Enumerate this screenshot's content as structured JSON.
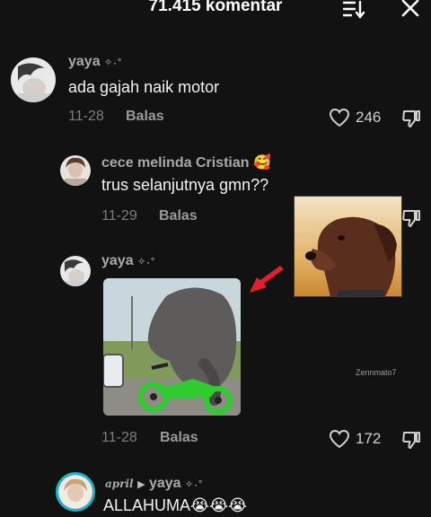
{
  "header": {
    "title": "71.415 komentar",
    "sort_icon": "sort-icon",
    "close_icon": "close-icon"
  },
  "comments": [
    {
      "username": "yaya",
      "badge": "✧˖°",
      "text": "ada gajah naik motor",
      "date": "11-28",
      "reply_label": "Balas",
      "likes": "246"
    },
    {
      "username": "cece melinda Cristian",
      "badge": "🥰",
      "text": "trus selanjutnya gmn??",
      "date": "11-29",
      "reply_label": "Balas"
    },
    {
      "username": "yaya",
      "badge": "✧˖°",
      "date": "11-28",
      "reply_label": "Balas",
      "likes": "172"
    },
    {
      "username": "april",
      "reply_to": "yaya",
      "badge": "✧˖°",
      "text": "ALLAHUMA😭😭😭"
    }
  ],
  "overlay": {
    "watermark": "Zennmato7"
  },
  "colors": {
    "background": "#121212",
    "arrow": "#e0202a",
    "bike": "#2ecc2e"
  }
}
